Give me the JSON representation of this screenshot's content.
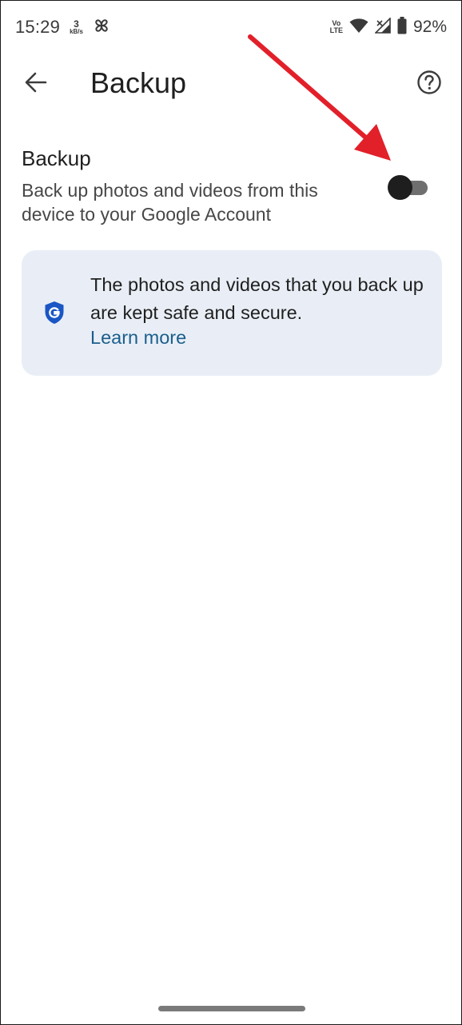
{
  "status_bar": {
    "time": "15:29",
    "net_speed_value": "3",
    "net_speed_unit": "kB/s",
    "volte_top": "Vo",
    "volte_bottom": "LTE",
    "battery": "92%"
  },
  "app_bar": {
    "title": "Backup",
    "back_icon": "arrow-back-icon",
    "help_icon": "help-circle-icon"
  },
  "backup_setting": {
    "title": "Backup",
    "description": "Back up photos and videos from this device to your Google Account",
    "enabled": false
  },
  "info_card": {
    "icon": "google-shield-icon",
    "text": "The photos and videos that you back up are kept safe and secure.",
    "link": "Learn more"
  },
  "colors": {
    "card_background": "#e9eef6",
    "link": "#1b5e8c",
    "shield_blue": "#1a56c4",
    "annotation_arrow": "#e2202a"
  }
}
